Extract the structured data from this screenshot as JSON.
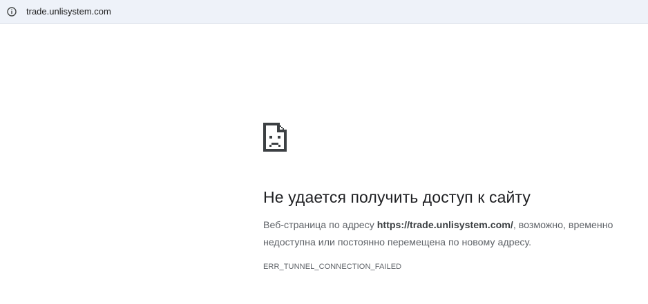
{
  "address_bar": {
    "icon": "info-icon",
    "url": "trade.unlisystem.com"
  },
  "error": {
    "icon": "sad-page-icon",
    "title": "Не удается получить доступ к сайту",
    "description_prefix": "Веб-страница по адресу ",
    "description_url": "https://trade.unlisystem.com/",
    "description_suffix": ", возможно, временно недоступна или постоянно перемещена по новому адресу.",
    "code": "ERR_TUNNEL_CONNECTION_FAILED"
  }
}
